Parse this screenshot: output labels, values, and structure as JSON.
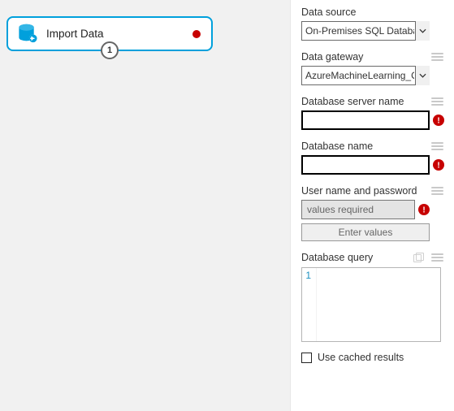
{
  "module": {
    "title": "Import Data",
    "port": "1"
  },
  "panel": {
    "data_source": {
      "label": "Data source",
      "value": "On-Premises SQL Database"
    },
    "data_gateway": {
      "label": "Data gateway",
      "value": "AzureMachineLearning_On"
    },
    "db_server": {
      "label": "Database server name",
      "value": ""
    },
    "db_name": {
      "label": "Database name",
      "value": ""
    },
    "credentials": {
      "label": "User name and password",
      "status": "values required",
      "button": "Enter values"
    },
    "query": {
      "label": "Database query",
      "line": "1",
      "text": ""
    },
    "cache": {
      "label": "Use cached results"
    }
  }
}
